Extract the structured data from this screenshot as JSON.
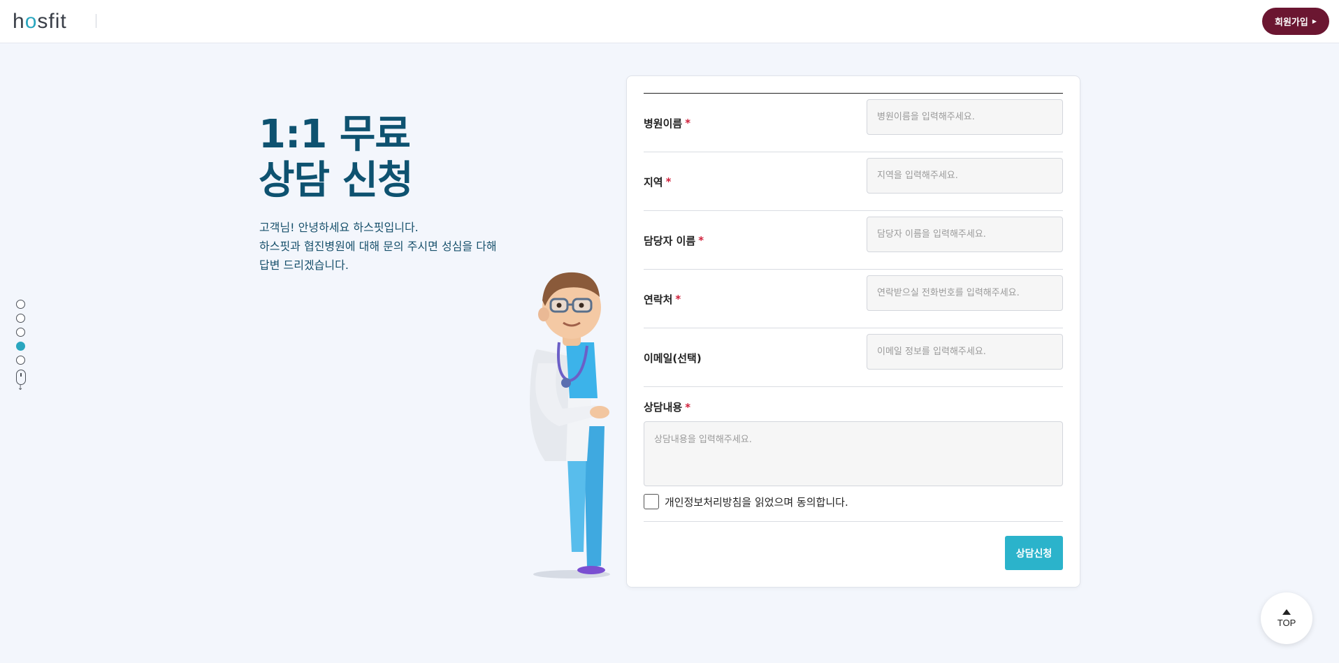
{
  "header": {
    "logo_text": "hosfit",
    "signup_label": "회원가입",
    "signup_arrow": "▶"
  },
  "intro": {
    "title_line1": "1:1 무료",
    "title_line2": "상담 신청",
    "desc_line1": "고객님! 안녕하세요 하스핏입니다.",
    "desc_line2": "하스핏과 협진병원에 대해 문의 주시면 성심을 다해",
    "desc_line3": "답변 드리겠습니다."
  },
  "side_nav": {
    "dots": 5,
    "active_index": 3,
    "scroll_arrow": "↓"
  },
  "form": {
    "rows": [
      {
        "label": "병원이름",
        "required": "*",
        "placeholder": "병원이름을 입력해주세요."
      },
      {
        "label": "지역",
        "required": "*",
        "placeholder": "지역을 입력해주세요."
      },
      {
        "label": "담당자 이름",
        "required": "*",
        "placeholder": "담당자 이름을 입력해주세요."
      },
      {
        "label": "연락처",
        "required": "*",
        "placeholder": "연락받으실 전화번호를 입력해주세요."
      },
      {
        "label": "이메일(선택)",
        "required": "",
        "placeholder": "이메일 정보를 입력해주세요."
      }
    ],
    "content_label": "상담내용",
    "content_required": "*",
    "content_placeholder": "상담내용을 입력해주세요.",
    "agree_text": "개인정보처리방침을 읽었으며 동의합니다.",
    "agree_checked": false,
    "submit_label": "상담신청"
  },
  "top_button": {
    "label": "TOP"
  },
  "colors": {
    "brand": "#6b1631",
    "accent": "#2bb3cb",
    "title": "#0e5270",
    "background": "#f3f6fc"
  }
}
